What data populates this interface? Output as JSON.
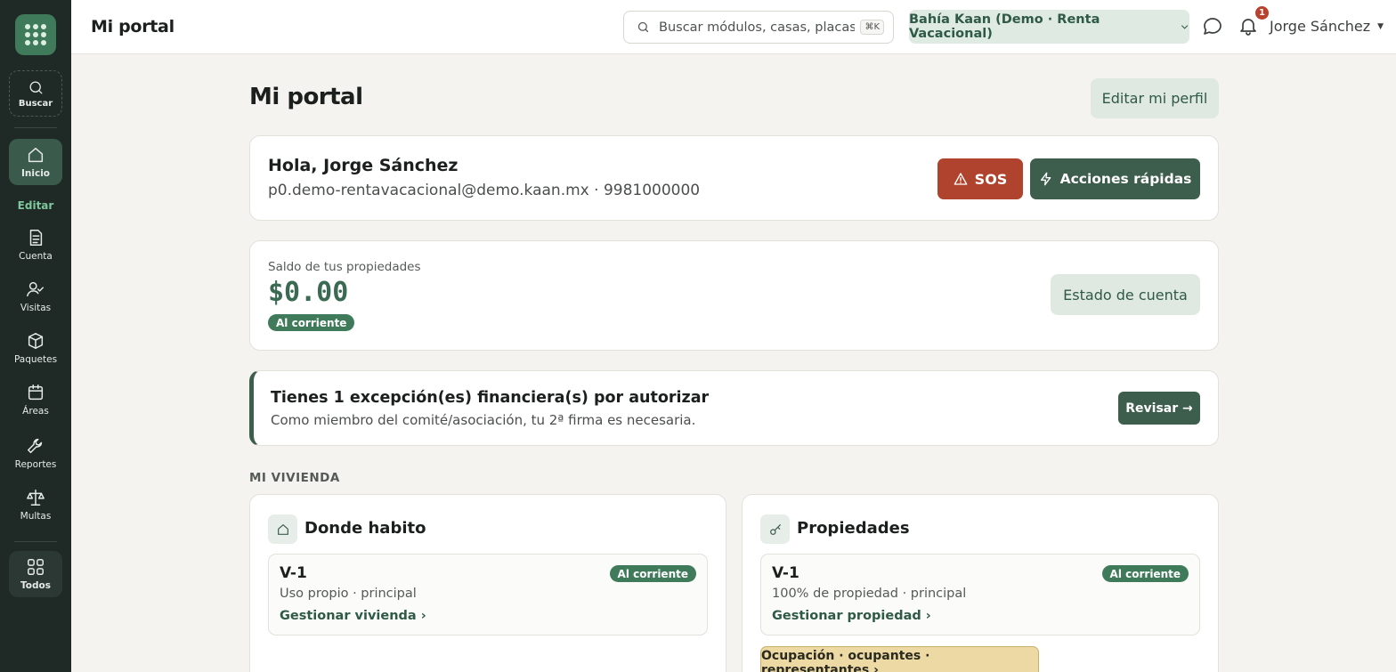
{
  "topbar": {
    "title": "Mi portal",
    "search_placeholder": "Buscar módulos, casas, placas…",
    "search_shortcut": "⌘K",
    "context": "Bahía Kaan (Demo · Renta Vacacional)",
    "notification_count": "1",
    "user_name": "Jorge Sánchez"
  },
  "sidebar": {
    "search_label": "Buscar",
    "edit_label": "Editar",
    "items": [
      {
        "label": "Inicio",
        "icon": "home-icon"
      },
      {
        "label": "Cuenta",
        "icon": "document-icon"
      },
      {
        "label": "Visitas",
        "icon": "user-check-icon"
      },
      {
        "label": "Paquetes",
        "icon": "package-icon"
      },
      {
        "label": "Áreas",
        "icon": "calendar-icon"
      },
      {
        "label": "Reportes",
        "icon": "wrench-icon"
      },
      {
        "label": "Multas",
        "icon": "scale-icon"
      },
      {
        "label": "Todos",
        "icon": "grid-icon"
      }
    ]
  },
  "main": {
    "page_title": "Mi portal",
    "edit_profile": "Editar mi perfil",
    "greeting": "Hola, Jorge Sánchez",
    "contact": "p0.demo-rentavacacional@demo.kaan.mx · 9981000000",
    "sos": "SOS",
    "quick_actions": "Acciones rápidas",
    "balance": {
      "label": "Saldo de tus propiedades",
      "value": "$0.00",
      "status": "Al corriente",
      "statement_button": "Estado de cuenta"
    },
    "alert": {
      "title": "Tienes 1 excepción(es) financiera(s) por autorizar",
      "subtitle": "Como miembro del comité/asociación, tu 2ª firma es necesaria.",
      "button": "Revisar →"
    },
    "section_label": "MI VIVIENDA",
    "home": {
      "title": "Donde habito",
      "unit": "V-1",
      "status": "Al corriente",
      "detail": "Uso propio · principal",
      "link": "Gestionar vivienda ›"
    },
    "properties": {
      "title": "Propiedades",
      "unit": "V-1",
      "status": "Al corriente",
      "detail": "100% de propiedad · principal",
      "link": "Gestionar propiedad ›",
      "occupancy_button": "Ocupación · ocupantes · representantes ›"
    }
  },
  "colors": {
    "sidebar_bg": "#1f2a26",
    "accent_green": "#3d5e4d",
    "sos_red": "#b0432d",
    "status_green": "#3f7a5a",
    "occupancy_yellow": "#ecd9a3"
  }
}
